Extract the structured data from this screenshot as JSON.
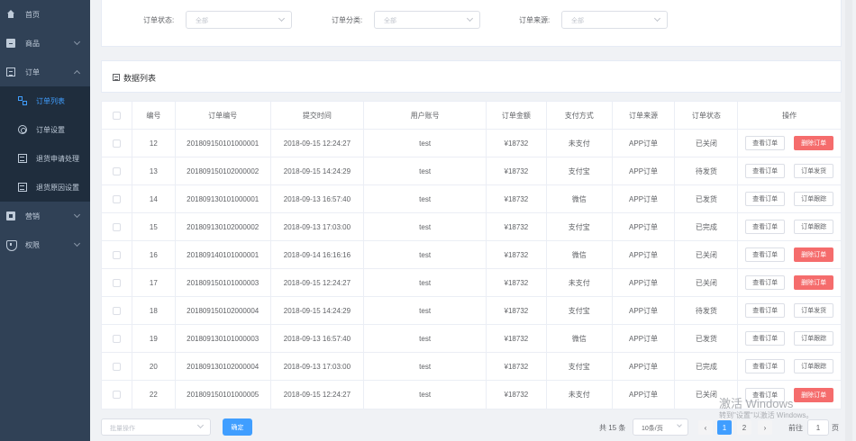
{
  "sidebar": {
    "items": [
      {
        "label": "首页",
        "icon": "home-icon"
      },
      {
        "label": "商品",
        "icon": "box-icon"
      },
      {
        "label": "订单",
        "icon": "order-icon"
      },
      {
        "label": "营销",
        "icon": "sale-icon"
      },
      {
        "label": "权限",
        "icon": "shield-icon"
      }
    ],
    "order_sub": [
      {
        "label": "订单列表",
        "icon": "grid-icon"
      },
      {
        "label": "订单设置",
        "icon": "gear-icon"
      },
      {
        "label": "退货申请处理",
        "icon": "list-icon"
      },
      {
        "label": "退货原因设置",
        "icon": "list-icon"
      }
    ]
  },
  "filters": {
    "status_label": "订单状态:",
    "status_value": "全部",
    "category_label": "订单分类:",
    "category_value": "全部",
    "source_label": "订单来源:",
    "source_value": "全部"
  },
  "list": {
    "title": "数据列表"
  },
  "table": {
    "headers": [
      "编号",
      "订单编号",
      "提交时间",
      "用户账号",
      "订单金额",
      "支付方式",
      "订单来源",
      "订单状态",
      "操作"
    ],
    "rows": [
      {
        "id": "12",
        "sn": "201809150101000001",
        "time": "2018-09-15 12:24:27",
        "user": "test",
        "amount": "¥18732",
        "pay": "未支付",
        "source": "APP订单",
        "status": "已关闭",
        "btn1": "查看订单",
        "btn2": "删除订单",
        "btn2_type": "danger"
      },
      {
        "id": "13",
        "sn": "201809150102000002",
        "time": "2018-09-15 14:24:29",
        "user": "test",
        "amount": "¥18732",
        "pay": "支付宝",
        "source": "APP订单",
        "status": "待发货",
        "btn1": "查看订单",
        "btn2": "订单发货",
        "btn2_type": "default"
      },
      {
        "id": "14",
        "sn": "201809130101000001",
        "time": "2018-09-13 16:57:40",
        "user": "test",
        "amount": "¥18732",
        "pay": "微信",
        "source": "APP订单",
        "status": "已发货",
        "btn1": "查看订单",
        "btn2": "订单跟踪",
        "btn2_type": "default"
      },
      {
        "id": "15",
        "sn": "201809130102000002",
        "time": "2018-09-13 17:03:00",
        "user": "test",
        "amount": "¥18732",
        "pay": "支付宝",
        "source": "APP订单",
        "status": "已完成",
        "btn1": "查看订单",
        "btn2": "订单跟踪",
        "btn2_type": "default"
      },
      {
        "id": "16",
        "sn": "201809140101000001",
        "time": "2018-09-14 16:16:16",
        "user": "test",
        "amount": "¥18732",
        "pay": "微信",
        "source": "APP订单",
        "status": "已关闭",
        "btn1": "查看订单",
        "btn2": "删除订单",
        "btn2_type": "danger"
      },
      {
        "id": "17",
        "sn": "201809150101000003",
        "time": "2018-09-15 12:24:27",
        "user": "test",
        "amount": "¥18732",
        "pay": "未支付",
        "source": "APP订单",
        "status": "已关闭",
        "btn1": "查看订单",
        "btn2": "删除订单",
        "btn2_type": "danger"
      },
      {
        "id": "18",
        "sn": "201809150102000004",
        "time": "2018-09-15 14:24:29",
        "user": "test",
        "amount": "¥18732",
        "pay": "支付宝",
        "source": "APP订单",
        "status": "待发货",
        "btn1": "查看订单",
        "btn2": "订单发货",
        "btn2_type": "default"
      },
      {
        "id": "19",
        "sn": "201809130101000003",
        "time": "2018-09-13 16:57:40",
        "user": "test",
        "amount": "¥18732",
        "pay": "微信",
        "source": "APP订单",
        "status": "已发货",
        "btn1": "查看订单",
        "btn2": "订单跟踪",
        "btn2_type": "default"
      },
      {
        "id": "20",
        "sn": "201809130102000004",
        "time": "2018-09-13 17:03:00",
        "user": "test",
        "amount": "¥18732",
        "pay": "支付宝",
        "source": "APP订单",
        "status": "已完成",
        "btn1": "查看订单",
        "btn2": "订单跟踪",
        "btn2_type": "default"
      },
      {
        "id": "22",
        "sn": "201809150101000005",
        "time": "2018-09-15 12:24:27",
        "user": "test",
        "amount": "¥18732",
        "pay": "未支付",
        "source": "APP订单",
        "status": "已关闭",
        "btn1": "查看订单",
        "btn2": "删除订单",
        "btn2_type": "danger"
      }
    ]
  },
  "footer": {
    "batch_placeholder": "批量操作",
    "confirm_label": "确定",
    "total": "共 15 条",
    "page_size": "10条/页",
    "prev": "‹",
    "page1": "1",
    "page2": "2",
    "next": "›",
    "goto": "前往",
    "goto_value": "1",
    "page_unit": "页"
  },
  "watermark": {
    "line1": "激活 Windows",
    "line2": "转到\"设置\"以激活 Windows。"
  },
  "colors": {
    "sidebar_bg": "#304156",
    "submenu_bg": "#1f2d3d",
    "primary": "#409eff",
    "danger": "#f56c6c"
  }
}
